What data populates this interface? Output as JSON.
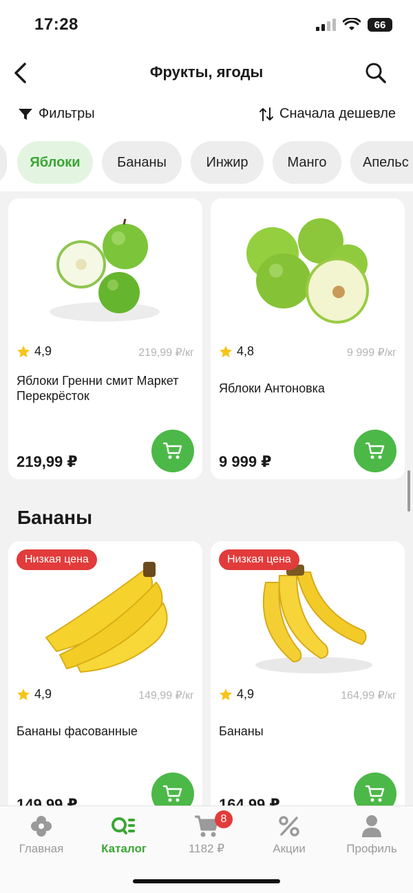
{
  "status_bar": {
    "time": "17:28",
    "battery": "66"
  },
  "header": {
    "title": "Фрукты, ягоды"
  },
  "toolbar": {
    "filters_label": "Фильтры",
    "sort_label": "Сначала дешевле"
  },
  "chips": [
    "Яблоки",
    "Бананы",
    "Инжир",
    "Манго",
    "Апельс"
  ],
  "active_chip": "Яблоки",
  "products_apples": [
    {
      "rating": "4,9",
      "unit_price": "219,99 ₽/кг",
      "name": "Яблоки Гренни смит Маркет Перекрёсток",
      "price": "219,99 ₽"
    },
    {
      "rating": "4,8",
      "unit_price": "9 999 ₽/кг",
      "name": "Яблоки Антоновка",
      "price": "9 999 ₽"
    }
  ],
  "bananas_section": {
    "title": "Бананы"
  },
  "products_bananas": [
    {
      "badge": "Низкая цена",
      "rating": "4,9",
      "unit_price": "149,99 ₽/кг",
      "name": "Бананы фасованные",
      "price": "149,99 ₽"
    },
    {
      "badge": "Низкая цена",
      "rating": "4,9",
      "unit_price": "164,99 ₽/кг",
      "name": "Бананы",
      "price": "164,99 ₽"
    }
  ],
  "tabbar": {
    "home": "Главная",
    "catalog": "Каталог",
    "cart": "1182 ₽",
    "cart_count": "8",
    "promos": "Акции",
    "profile": "Профиль"
  },
  "colors": {
    "accent_green": "#4cb848",
    "badge_red": "#e23b3b",
    "active_chip_bg": "#e3f5e1"
  },
  "icons": [
    "back-icon",
    "search-icon",
    "filter-icon",
    "sort-icon",
    "star-icon",
    "cart-icon",
    "home-icon",
    "catalog-icon",
    "percent-icon",
    "profile-icon"
  ]
}
